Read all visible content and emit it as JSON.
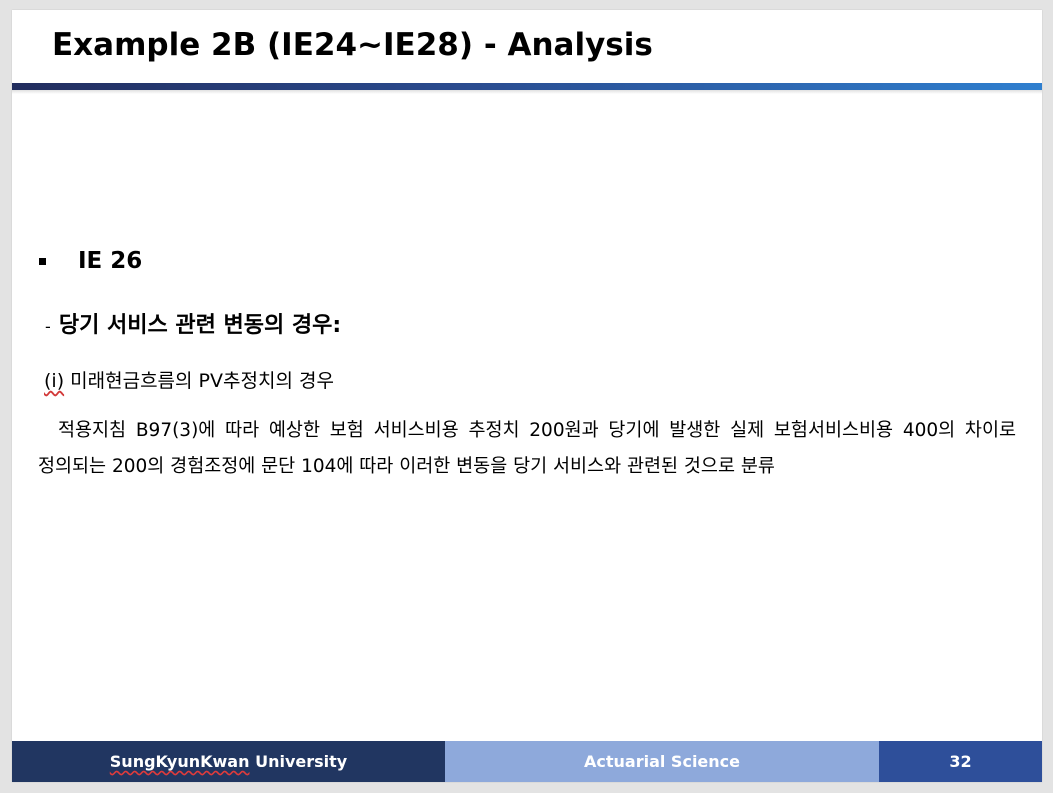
{
  "slide": {
    "title": "Example 2B (IE24~IE28) - Analysis",
    "bullet": "IE 26",
    "subheading_dash": "-",
    "subheading": "당기 서비스 관련 변동의 경우:",
    "case_marker": "(i)",
    "case_text": "미래현금흐름의 PV추정치의 경우",
    "paragraph": "적용지침 B97(3)에 따라 예상한 보험 서비스비용 추정치 200원과 당기에 발생한 실제 보험서비스비용 400의 차이로 정의되는 200의 경험조정에 문단 104에 따라 이러한 변동을 당기 서비스와 관련된 것으로 분류"
  },
  "footer": {
    "university_first": "SungKyunKwan",
    "university_second": "University",
    "department": "Actuarial Science",
    "page_number": "32"
  },
  "colors": {
    "footer_left": "#213661",
    "footer_mid": "#8ea9db",
    "footer_right": "#2e4f9a",
    "title_rule_start": "#222d5e",
    "title_rule_end": "#2f7fcf"
  }
}
